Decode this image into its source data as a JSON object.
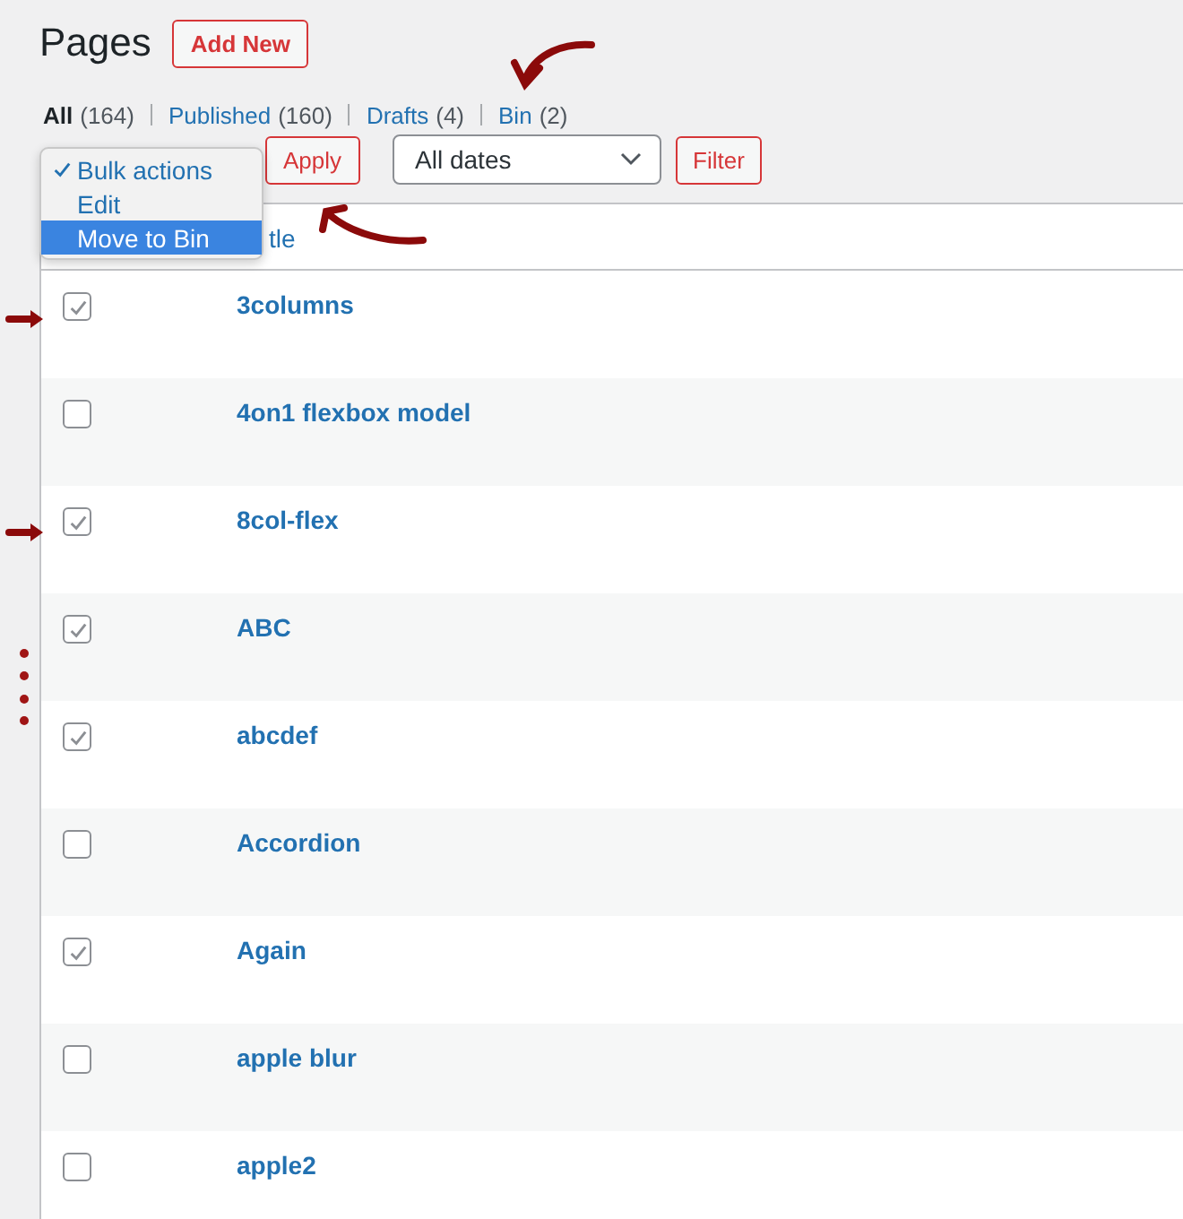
{
  "page_title": "Pages",
  "add_new_button": "Add New",
  "status_filters": [
    {
      "label": "All",
      "count": "(164)",
      "selected": true
    },
    {
      "label": "Published",
      "count": "(160)",
      "selected": false
    },
    {
      "label": "Drafts",
      "count": "(4)",
      "selected": false
    },
    {
      "label": "Bin",
      "count": "(2)",
      "selected": false
    }
  ],
  "bulk_actions_menu": [
    {
      "label": "Bulk actions",
      "checked": true,
      "selected": false
    },
    {
      "label": "Edit",
      "checked": false,
      "selected": false
    },
    {
      "label": "Move to Bin",
      "checked": false,
      "selected": true
    }
  ],
  "apply_button": "Apply",
  "date_filter": {
    "value": "All dates"
  },
  "filter_button": "Filter",
  "table": {
    "header_title": "tle",
    "rows": [
      {
        "title": "3columns",
        "checked": true
      },
      {
        "title": "4on1 flexbox model",
        "checked": false
      },
      {
        "title": "8col-flex",
        "checked": true
      },
      {
        "title": "ABC",
        "checked": true
      },
      {
        "title": "abcdef",
        "checked": true
      },
      {
        "title": "Accordion",
        "checked": false
      },
      {
        "title": "Again",
        "checked": true
      },
      {
        "title": "apple blur",
        "checked": false
      },
      {
        "title": "apple2",
        "checked": false
      }
    ]
  }
}
